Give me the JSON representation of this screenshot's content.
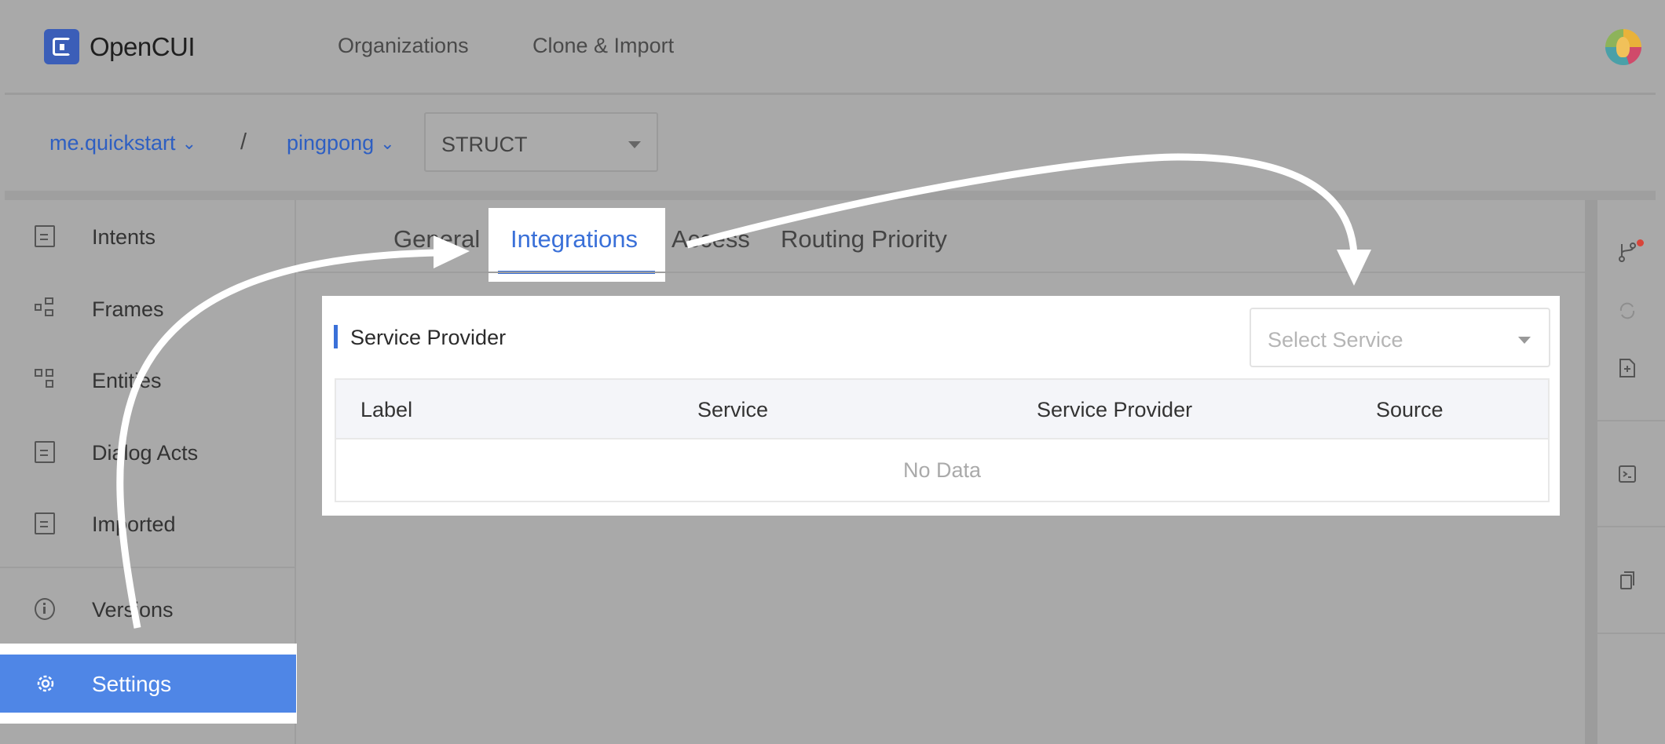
{
  "app": {
    "name": "OpenCUI"
  },
  "topnav": [
    "Organizations",
    "Clone & Import"
  ],
  "breadcrumb": {
    "org": "me.quickstart",
    "separator": "/",
    "project": "pingpong",
    "type_select": "STRUCT"
  },
  "sidebar": {
    "items": [
      {
        "label": "Intents",
        "icon": "document-icon"
      },
      {
        "label": "Frames",
        "icon": "frames-icon"
      },
      {
        "label": "Entities",
        "icon": "entities-icon"
      },
      {
        "label": "Dialog Acts",
        "icon": "dialog-acts-icon"
      },
      {
        "label": "Imported",
        "icon": "imported-icon"
      },
      {
        "label": "Versions",
        "icon": "info-circle-icon"
      }
    ],
    "active": {
      "label": "Settings",
      "icon": "gear-icon"
    }
  },
  "tabs": [
    "General",
    "Integrations",
    "Access",
    "Routing Priority"
  ],
  "active_tab": "Integrations",
  "panel": {
    "title": "Service Provider",
    "select_placeholder": "Select Service",
    "columns": [
      "Label",
      "Service",
      "Service Provider",
      "Source"
    ],
    "empty_text": "No Data"
  },
  "colors": {
    "accent": "#3a70d8",
    "active_bg": "#4f86e6",
    "notification": "#d8453a"
  }
}
